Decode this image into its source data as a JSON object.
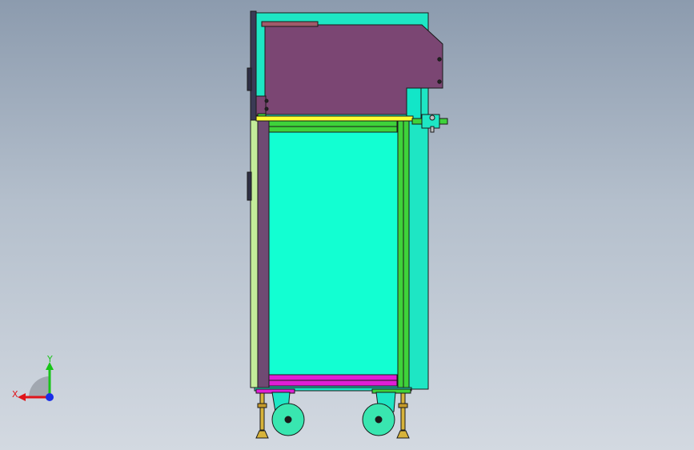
{
  "viewport": {
    "background_top": "#8c9bae",
    "background_bottom": "#d3d9e1"
  },
  "model": {
    "colors": {
      "cabinet_panel": "#12ffd2",
      "cabinet_back": "#1ee6c4",
      "hood": "#7b4673",
      "side_frame": "#6f4a73",
      "left_panel": "#c4ec9a",
      "green_frame": "#3ed23a",
      "yellow_rail": "#ffff33",
      "magenta_base": "#e01ed6",
      "caster_wheel": "#39e6b0",
      "leveling_foot": "#d7b33a",
      "edge": "#1a1a1a"
    }
  },
  "triad": {
    "x_label": "X",
    "y_label": "Y",
    "x_color": "#e0141a",
    "y_color": "#18c418",
    "z_color": "#1a2ee8"
  }
}
